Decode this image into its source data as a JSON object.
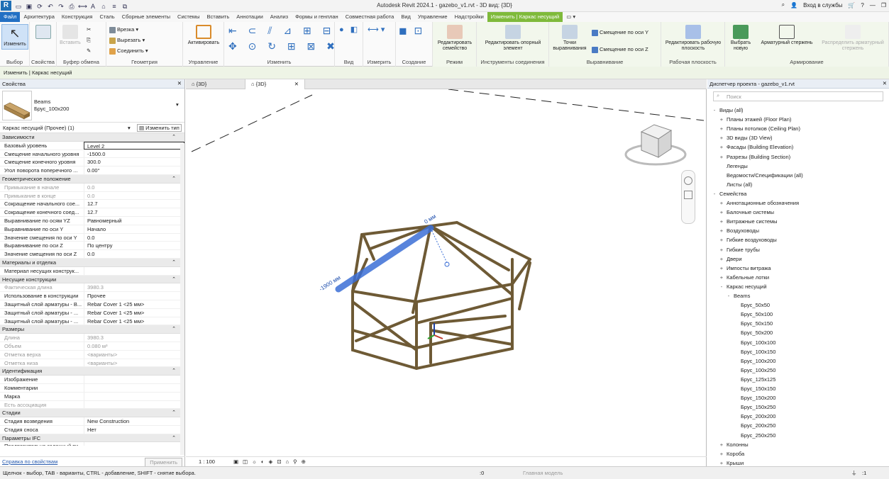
{
  "app_title": "Autodesk Revit 2024.1 - gazebo_v1.rvt - 3D вид: {3D}",
  "app_logo": "R",
  "signin": "Вход в службы",
  "tabs": [
    "Файл",
    "Архитектура",
    "Конструкция",
    "Сталь",
    "Сборные элементы",
    "Системы",
    "Вставить",
    "Аннотации",
    "Анализ",
    "Формы и генплан",
    "Совместная работа",
    "Вид",
    "Управление",
    "Надстройки",
    "Изменить | Каркас несущий"
  ],
  "ribbon": {
    "select": {
      "modify": "Изменить",
      "label": "Выбор"
    },
    "props": {
      "label": "Свойства",
      "btn": "Свойства"
    },
    "clip": {
      "paste": "Вставить",
      "label": "Буфер обмена"
    },
    "geom": {
      "cut": "Врезка",
      "cut2": "Вырезать",
      "join": "Соединить",
      "label": "Геометрия"
    },
    "manage": {
      "activate": "Активировать",
      "label": "Управление"
    },
    "modify": {
      "label": "Изменить"
    },
    "view": {
      "label": "Вид"
    },
    "measure": {
      "label": "Измерить"
    },
    "create": {
      "label": "Создание"
    },
    "mode": {
      "edit_family": "Редактировать семейство",
      "label": "Режим"
    },
    "conn": {
      "edit_ref": "Редактировать опорный элемент",
      "label": "Инструменты соединения"
    },
    "align": {
      "points": "Точки выравнивания",
      "offy": "Смещение по оси Y",
      "offz": "Смещение по оси Z",
      "label": "Выравнивание"
    },
    "wp": {
      "edit": "Редактировать рабочую плоскость",
      "label": "Рабочая плоскость"
    },
    "rebar": {
      "pick": "Выбрать новую",
      "arm": "Арматурный стержень",
      "dist": "Распределить арматурный стержень",
      "label": "Армирование"
    }
  },
  "optionsbar": "Изменить | Каркас несущий",
  "properties": {
    "title": "Свойства",
    "type_family": "Beams",
    "type_name": "Брус_100x200",
    "instance": "Каркас несущий (Прочее) (1)",
    "edit_type": "Изменить тип",
    "groups": [
      {
        "name": "Зависимости",
        "rows": [
          [
            "Базовый уровень",
            "Level 2",
            false
          ],
          [
            "Смещение начального уровня",
            "-1500.0",
            false
          ],
          [
            "Смещение конечного уровня",
            "300.0",
            false
          ],
          [
            "Угол поворота поперечного ...",
            "0.00°",
            false
          ]
        ]
      },
      {
        "name": "Геометрическое положение",
        "rows": [
          [
            "Примыкание в начале",
            "0.0",
            true
          ],
          [
            "Примыкание в конце",
            "0.0",
            true
          ],
          [
            "Сокращение начального сое...",
            "12.7",
            false
          ],
          [
            "Сокращение конечного соед...",
            "12.7",
            false
          ],
          [
            "Выравнивание по осям YZ",
            "Равномерный",
            false
          ],
          [
            "Выравнивание по оси Y",
            "Начало",
            false
          ],
          [
            "Значение смещения по оси Y",
            "0.0",
            false
          ],
          [
            "Выравнивание по оси Z",
            "По центру",
            false
          ],
          [
            "Значение смещения по оси Z",
            "0.0",
            false
          ]
        ]
      },
      {
        "name": "Материалы и отделка",
        "rows": [
          [
            "Материал несущих конструк...",
            "",
            false
          ]
        ]
      },
      {
        "name": "Несущие конструкции",
        "rows": [
          [
            "Фактическая длина",
            "3980.3",
            true
          ],
          [
            "Использование в конструкции",
            "Прочее",
            false
          ],
          [
            "Защитный слой арматуры - В...",
            "Rebar Cover 1 <25 мм>",
            false
          ],
          [
            "Защитный слой арматуры - ...",
            "Rebar Cover 1 <25 мм>",
            false
          ],
          [
            "Защитный слой арматуры - ...",
            "Rebar Cover 1 <25 мм>",
            false
          ]
        ]
      },
      {
        "name": "Размеры",
        "rows": [
          [
            "Длина",
            "3980.3",
            true
          ],
          [
            "Объем",
            "0.080 м³",
            true
          ],
          [
            "Отметка верха",
            "<варианты>",
            true
          ],
          [
            "Отметка низа",
            "<варианты>",
            true
          ]
        ]
      },
      {
        "name": "Идентификация",
        "rows": [
          [
            "Изображение",
            "",
            false
          ],
          [
            "Комментарии",
            "",
            false
          ],
          [
            "Марка",
            "",
            false
          ],
          [
            "Есть ассоциация",
            "",
            true
          ]
        ]
      },
      {
        "name": "Стадии",
        "rows": [
          [
            "Стадия возведения",
            "New Construction",
            false
          ],
          [
            "Стадия сноса",
            "Нет",
            false
          ]
        ]
      },
      {
        "name": "Параметры IFC",
        "rows": [
          [
            "Предварительно заданный ти...",
            "",
            false
          ]
        ]
      }
    ],
    "help_link": "Справка по свойствам",
    "apply": "Применить"
  },
  "view_tabs": [
    "{3D}",
    "{3D}"
  ],
  "view_scale": "1 : 100",
  "dimension": "-1900 мм",
  "dimension2": "0 мм",
  "browser": {
    "title": "Диспетчер проекта - gazebo_v1.rvt",
    "search": "Поиск",
    "nodes": [
      [
        0,
        "-",
        "Виды (all)"
      ],
      [
        1,
        "+",
        "Планы этажей (Floor Plan)"
      ],
      [
        1,
        "+",
        "Планы потолков (Ceiling Plan)"
      ],
      [
        1,
        "+",
        "3D виды (3D View)"
      ],
      [
        1,
        "+",
        "Фасады (Building Elevation)"
      ],
      [
        1,
        "+",
        "Разрезы (Building Section)"
      ],
      [
        1,
        "",
        "Легенды"
      ],
      [
        1,
        "",
        "Ведомости/Спецификации (all)"
      ],
      [
        1,
        "",
        "Листы (all)"
      ],
      [
        0,
        "-",
        "Семейства"
      ],
      [
        1,
        "+",
        "Аннотационные обозначения"
      ],
      [
        1,
        "+",
        "Балочные системы"
      ],
      [
        1,
        "+",
        "Витражные системы"
      ],
      [
        1,
        "+",
        "Воздуховоды"
      ],
      [
        1,
        "+",
        "Гибкие воздуховоды"
      ],
      [
        1,
        "+",
        "Гибкие трубы"
      ],
      [
        1,
        "+",
        "Двери"
      ],
      [
        1,
        "+",
        "Импосты витража"
      ],
      [
        1,
        "+",
        "Кабельные лотки"
      ],
      [
        1,
        "-",
        "Каркас несущий"
      ],
      [
        2,
        "-",
        "Beams"
      ],
      [
        3,
        "",
        "Брус_50x50"
      ],
      [
        3,
        "",
        "Брус_50x100"
      ],
      [
        3,
        "",
        "Брус_50x150"
      ],
      [
        3,
        "",
        "Брус_50x200"
      ],
      [
        3,
        "",
        "Брус_100x100"
      ],
      [
        3,
        "",
        "Брус_100x150"
      ],
      [
        3,
        "",
        "Брус_100x200"
      ],
      [
        3,
        "",
        "Брус_100x250"
      ],
      [
        3,
        "",
        "Брус_125x125"
      ],
      [
        3,
        "",
        "Брус_150x150"
      ],
      [
        3,
        "",
        "Брус_150x200"
      ],
      [
        3,
        "",
        "Брус_150x250"
      ],
      [
        3,
        "",
        "Брус_200x200"
      ],
      [
        3,
        "",
        "Брус_200x250"
      ],
      [
        3,
        "",
        "Брус_250x250"
      ],
      [
        1,
        "+",
        "Колонны"
      ],
      [
        1,
        "+",
        "Короба"
      ],
      [
        1,
        "+",
        "Крыши"
      ]
    ]
  },
  "status": {
    "hint": "Щелчок - выбор, TAB - варианты, CTRL - добавление, SHIFT - снятие выбора.",
    "zero": ":0",
    "model": "Главная модель",
    "filter": ":1"
  },
  "colors": {
    "accent": "#2370c4",
    "context": "#7fba3b",
    "beam": "#8a7a55",
    "selected": "#3b6fd6"
  }
}
